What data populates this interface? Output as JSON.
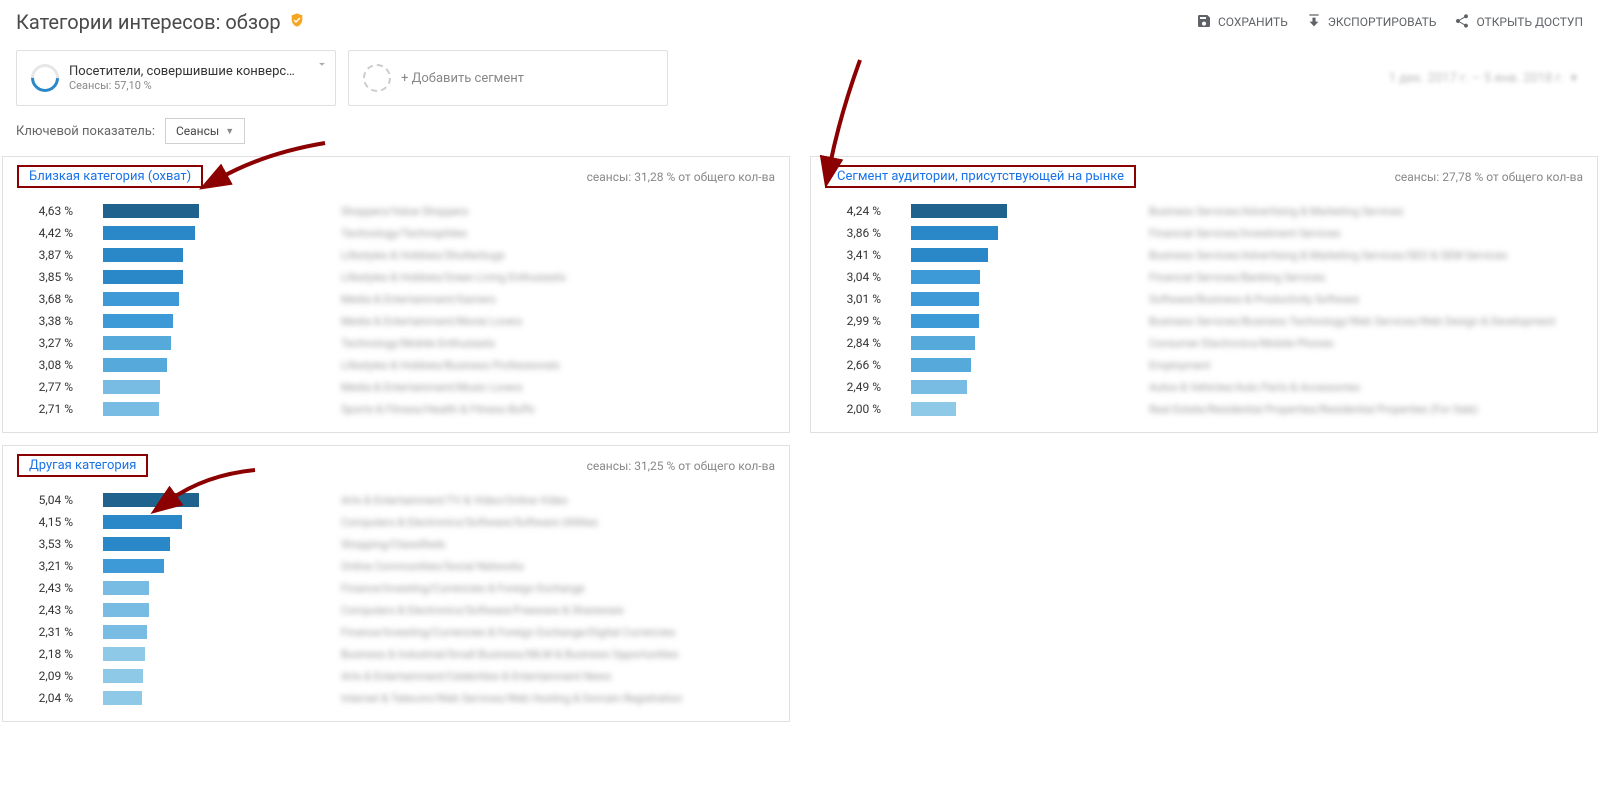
{
  "header": {
    "title": "Категории интересов: обзор",
    "actions": {
      "save": "СОХРАНИТЬ",
      "export": "ЭКСПОРТИРОВАТЬ",
      "share": "ОТКРЫТЬ ДОСТУП"
    }
  },
  "segments": {
    "primary": {
      "name": "Посетители, совершившие конверс…",
      "sub": "Сеансы: 57,10 %"
    },
    "add": "+ Добавить сегмент",
    "date_range": "1 дек. 2017 г. – 5 янв. 2018 г."
  },
  "metric": {
    "label": "Ключевой показатель:",
    "value": "Сеансы"
  },
  "sessions_label_prefix": "сеансы:",
  "sessions_label_suffix": "от общего кол-ва",
  "chart_data": [
    {
      "id": "affinity",
      "title": "Близкая категория (охват)",
      "sessions_pct": "31,28 %",
      "type": "bar",
      "max": 4.63,
      "rows": [
        {
          "pct": "4,63 %",
          "v": 4.63,
          "color": "#1f628e",
          "label": "Shoppers/Value Shoppers"
        },
        {
          "pct": "4,42 %",
          "v": 4.42,
          "color": "#2a88c9",
          "label": "Technology/Technophiles"
        },
        {
          "pct": "3,87 %",
          "v": 3.87,
          "color": "#2a88c9",
          "label": "Lifestyles & Hobbies/Shutterbugs"
        },
        {
          "pct": "3,85 %",
          "v": 3.85,
          "color": "#2a88c9",
          "label": "Lifestyles & Hobbies/Green Living Enthusiasts"
        },
        {
          "pct": "3,68 %",
          "v": 3.68,
          "color": "#3d9ad6",
          "label": "Media & Entertainment/Gamers"
        },
        {
          "pct": "3,38 %",
          "v": 3.38,
          "color": "#3d9ad6",
          "label": "Media & Entertainment/Movie Lovers"
        },
        {
          "pct": "3,27 %",
          "v": 3.27,
          "color": "#56a9db",
          "label": "Technology/Mobile Enthusiasts"
        },
        {
          "pct": "3,08 %",
          "v": 3.08,
          "color": "#56a9db",
          "label": "Lifestyles & Hobbies/Business Professionals"
        },
        {
          "pct": "2,77 %",
          "v": 2.77,
          "color": "#78bce3",
          "label": "Media & Entertainment/Music Lovers"
        },
        {
          "pct": "2,71 %",
          "v": 2.71,
          "color": "#78bce3",
          "label": "Sports & Fitness/Health & Fitness Buffs"
        }
      ]
    },
    {
      "id": "in_market",
      "title": "Сегмент аудитории, присутствующей на рынке",
      "sessions_pct": "27,78 %",
      "type": "bar",
      "max": 4.24,
      "rows": [
        {
          "pct": "4,24 %",
          "v": 4.24,
          "color": "#1f628e",
          "label": "Business Services/Advertising & Marketing Services"
        },
        {
          "pct": "3,86 %",
          "v": 3.86,
          "color": "#2a88c9",
          "label": "Financial Services/Investment Services"
        },
        {
          "pct": "3,41 %",
          "v": 3.41,
          "color": "#2a88c9",
          "label": "Business Services/Advertising & Marketing Services/SEO & SEM Services"
        },
        {
          "pct": "3,04 %",
          "v": 3.04,
          "color": "#3d9ad6",
          "label": "Financial Services/Banking Services"
        },
        {
          "pct": "3,01 %",
          "v": 3.01,
          "color": "#3d9ad6",
          "label": "Software/Business & Productivity Software"
        },
        {
          "pct": "2,99 %",
          "v": 2.99,
          "color": "#3d9ad6",
          "label": "Business Services/Business Technology/Web Services/Web Design & Development"
        },
        {
          "pct": "2,84 %",
          "v": 2.84,
          "color": "#56a9db",
          "label": "Consumer Electronics/Mobile Phones"
        },
        {
          "pct": "2,66 %",
          "v": 2.66,
          "color": "#56a9db",
          "label": "Employment"
        },
        {
          "pct": "2,49 %",
          "v": 2.49,
          "color": "#78bce3",
          "label": "Autos & Vehicles/Auto Parts & Accessories"
        },
        {
          "pct": "2,00 %",
          "v": 2.0,
          "color": "#8fc9e8",
          "label": "Real Estate/Residential Properties/Residential Properties (For Sale)"
        }
      ]
    },
    {
      "id": "other",
      "title": "Другая категория",
      "sessions_pct": "31,25 %",
      "type": "bar",
      "max": 5.04,
      "rows": [
        {
          "pct": "5,04 %",
          "v": 5.04,
          "color": "#1f628e",
          "label": "Arts & Entertainment/TV & Video/Online Video"
        },
        {
          "pct": "4,15 %",
          "v": 4.15,
          "color": "#2a88c9",
          "label": "Computers & Electronics/Software/Software Utilities"
        },
        {
          "pct": "3,53 %",
          "v": 3.53,
          "color": "#2a88c9",
          "label": "Shopping/Classifieds"
        },
        {
          "pct": "3,21 %",
          "v": 3.21,
          "color": "#3d9ad6",
          "label": "Online Communities/Social Networks"
        },
        {
          "pct": "2,43 %",
          "v": 2.43,
          "color": "#78bce3",
          "label": "Finance/Investing/Currencies & Foreign Exchange"
        },
        {
          "pct": "2,43 %",
          "v": 2.43,
          "color": "#78bce3",
          "label": "Computers & Electronics/Software/Freeware & Shareware"
        },
        {
          "pct": "2,31 %",
          "v": 2.31,
          "color": "#78bce3",
          "label": "Finance/Investing/Currencies & Foreign Exchange/Digital Currencies"
        },
        {
          "pct": "2,18 %",
          "v": 2.18,
          "color": "#8fc9e8",
          "label": "Business & Industrial/Small Business/MLM & Business Opportunities"
        },
        {
          "pct": "2,09 %",
          "v": 2.09,
          "color": "#8fc9e8",
          "label": "Arts & Entertainment/Celebrities & Entertainment News"
        },
        {
          "pct": "2,04 %",
          "v": 2.04,
          "color": "#8fc9e8",
          "label": "Internet & Telecom/Web Services/Web Hosting & Domain Registration"
        }
      ]
    }
  ]
}
